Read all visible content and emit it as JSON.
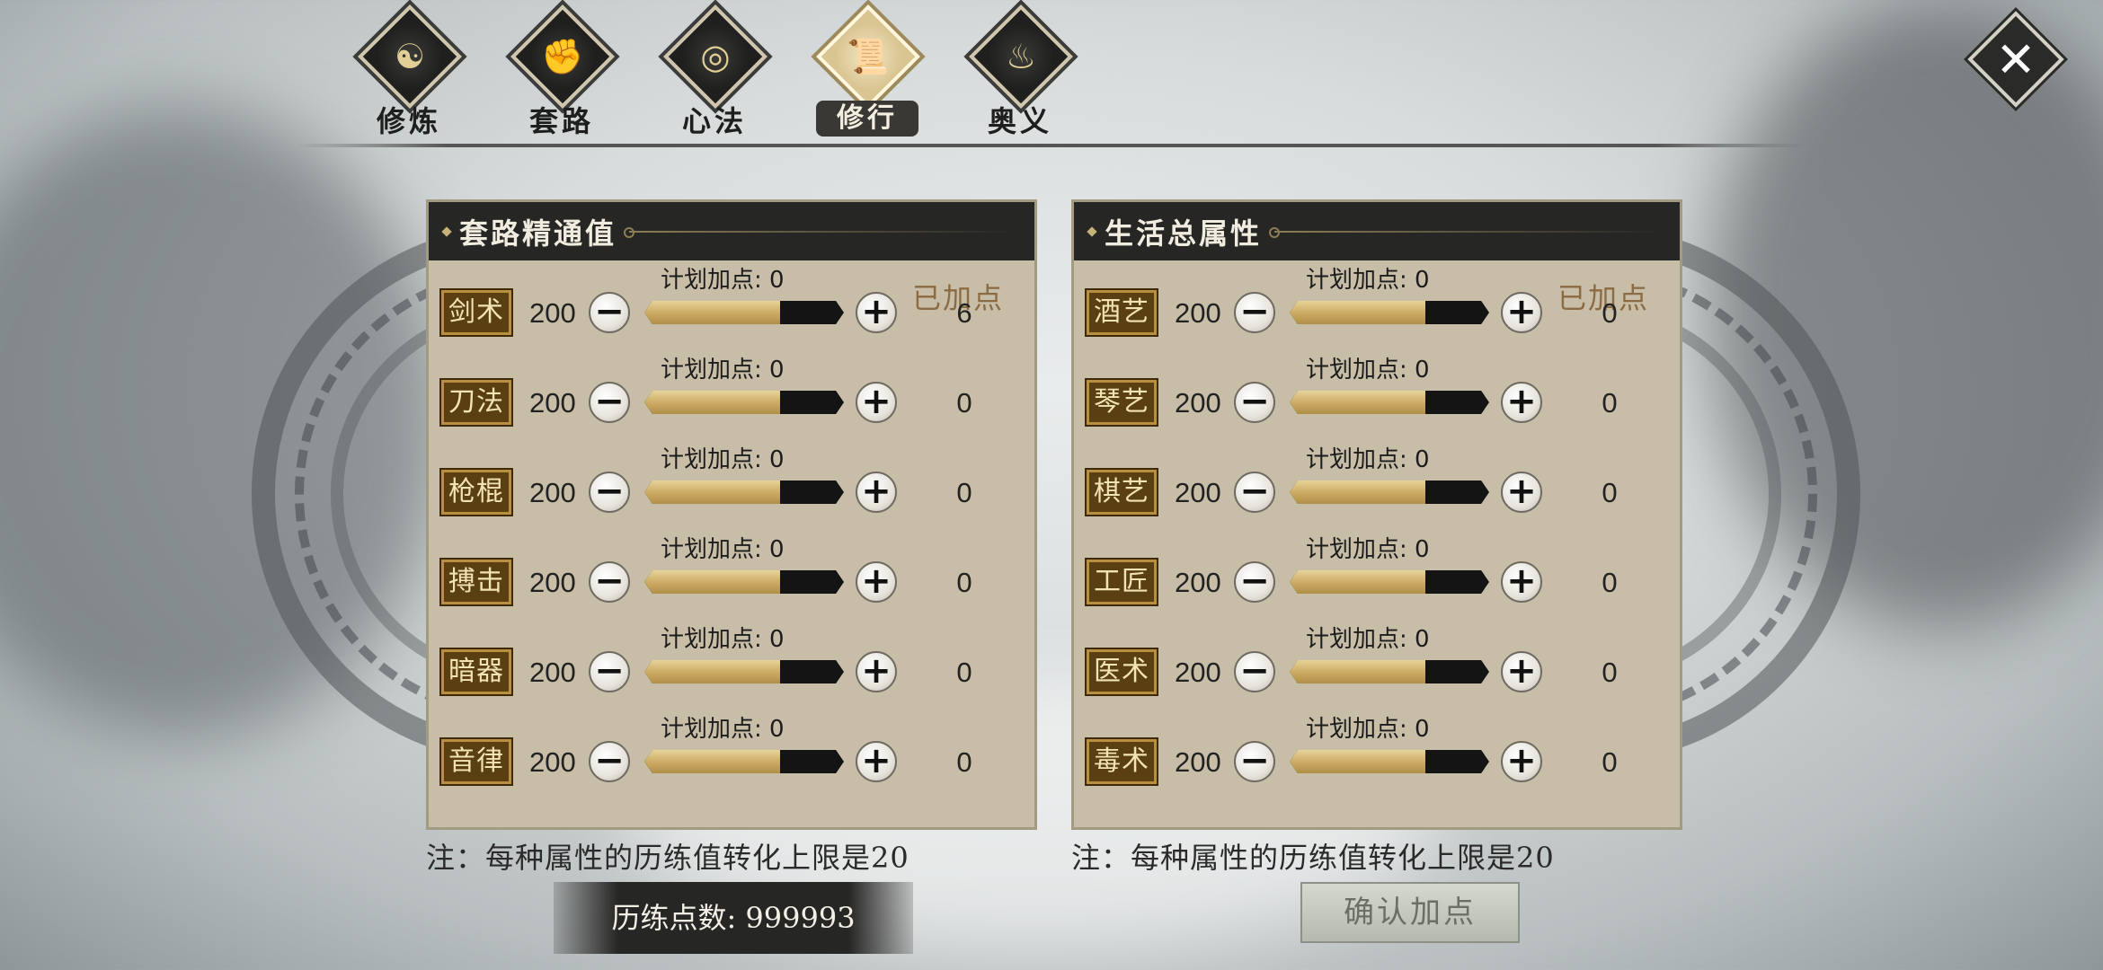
{
  "tabs": [
    {
      "label": "修炼",
      "glyph": "☯",
      "icon": "yin-yang-icon",
      "active": false
    },
    {
      "label": "套路",
      "glyph": "✊",
      "icon": "fist-icon",
      "active": false
    },
    {
      "label": "心法",
      "glyph": "◎",
      "icon": "swirl-icon",
      "active": false
    },
    {
      "label": "修行",
      "glyph": "📜",
      "icon": "scroll-icon",
      "active": true
    },
    {
      "label": "奥义",
      "glyph": "♨",
      "icon": "flame-icon",
      "active": false
    }
  ],
  "close_glyph": "✕",
  "left_panel": {
    "title": "套路精通值",
    "added_header": "已加点",
    "plan_prefix": "计划加点: ",
    "rows": [
      {
        "name": "剑术",
        "base": "200",
        "plan": "0",
        "added": "6"
      },
      {
        "name": "刀法",
        "base": "200",
        "plan": "0",
        "added": "0"
      },
      {
        "name": "枪棍",
        "base": "200",
        "plan": "0",
        "added": "0"
      },
      {
        "name": "搏击",
        "base": "200",
        "plan": "0",
        "added": "0"
      },
      {
        "name": "暗器",
        "base": "200",
        "plan": "0",
        "added": "0"
      },
      {
        "name": "音律",
        "base": "200",
        "plan": "0",
        "added": "0"
      }
    ],
    "note": "注：每种属性的历练值转化上限是20"
  },
  "right_panel": {
    "title": "生活总属性",
    "added_header": "已加点",
    "plan_prefix": "计划加点: ",
    "rows": [
      {
        "name": "酒艺",
        "base": "200",
        "plan": "0",
        "added": "0"
      },
      {
        "name": "琴艺",
        "base": "200",
        "plan": "0",
        "added": "0"
      },
      {
        "name": "棋艺",
        "base": "200",
        "plan": "0",
        "added": "0"
      },
      {
        "name": "工匠",
        "base": "200",
        "plan": "0",
        "added": "0"
      },
      {
        "name": "医术",
        "base": "200",
        "plan": "0",
        "added": "0"
      },
      {
        "name": "毒术",
        "base": "200",
        "plan": "0",
        "added": "0"
      }
    ],
    "note": "注：每种属性的历练值转化上限是20"
  },
  "points_label": "历练点数: 999993",
  "confirm_label": "确认加点",
  "colors": {
    "panel_bg": "#c8bea7",
    "header_bg": "#262624",
    "tag_bg": "#5a3f12",
    "bar_fill": "#caa962"
  }
}
